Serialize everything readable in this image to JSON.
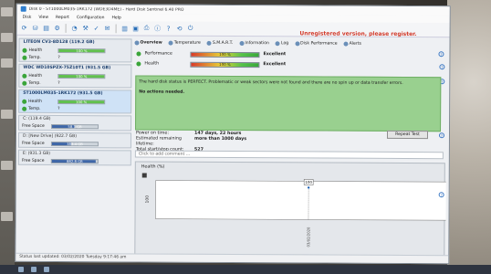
{
  "window": {
    "title": "Disk 0 - ST1000LM035-1RK172 (WDE3D4ME) - Hard Disk Sentinel 6.40 PRO",
    "unregistered": "Unregistered version, please register."
  },
  "menu": [
    "Disk",
    "View",
    "Report",
    "Configuration",
    "Help"
  ],
  "toolbar_icons": [
    "refresh-icon",
    "disk-icon",
    "report-icon",
    "settings-icon",
    "gauge-icon",
    "tools-icon",
    "test-icon",
    "email-icon",
    "chart-icon",
    "save-icon",
    "print-icon",
    "info-icon",
    "help-icon",
    "update-icon",
    "power-icon"
  ],
  "drives": [
    {
      "name": "LITEON CV3-8D128 (119.2 GB)",
      "health_label": "Health",
      "health": "100 %",
      "health_pct": 100,
      "temp_label": "Temp.",
      "temp": "?",
      "selected": false
    },
    {
      "name": "WDC WD10SPZX-75Z10T1 (931.5 GB)",
      "health_label": "Health",
      "health": "100 %",
      "health_pct": 100,
      "temp_label": "Temp.",
      "temp": "?",
      "selected": false
    },
    {
      "name": "ST1000LM035-1RK172 (931.5 GB)",
      "health_label": "Health",
      "health": "100 %",
      "health_pct": 100,
      "temp_label": "Temp.",
      "temp": "?",
      "selected": true
    }
  ],
  "volumes": [
    {
      "head": "C: (119.4 GB)",
      "label": "Free Space",
      "value": "58.1 GB",
      "pct": 49
    },
    {
      "head": "D: [New Drive] (922.7 GB)",
      "label": "Free Space",
      "value": "383.4 GB",
      "pct": 42
    },
    {
      "head": "E: (931.3 GB)",
      "label": "Free Space",
      "value": "882.8 GB",
      "pct": 95
    }
  ],
  "tabs": [
    "Overview",
    "Temperature",
    "S.M.A.R.T.",
    "Information",
    "Log",
    "Disk Performance",
    "Alerts"
  ],
  "metrics": [
    {
      "label": "Performance",
      "value": "100 %",
      "status": "Excellent"
    },
    {
      "label": "Health",
      "value": "100 %",
      "status": "Excellent"
    }
  ],
  "status": {
    "line1": "The hard disk status is PERFECT. Problematic or weak sectors were not found and there are no spin up or data transfer errors.",
    "line2": "No actions needed."
  },
  "info": [
    {
      "key": "Power on time:",
      "value": "147 days, 22 hours"
    },
    {
      "key": "Estimated remaining lifetime:",
      "value": "more than 1000 days"
    },
    {
      "key": "Total start/stop count:",
      "value": "527"
    }
  ],
  "repeat_test_label": "Repeat Test",
  "comment_placeholder": "Click to add comment ...",
  "chart_data": {
    "type": "line",
    "title": "Health (%)",
    "x": [
      "03/02/2020"
    ],
    "values": [
      100
    ],
    "ylabel": "100",
    "point_label": "100"
  },
  "statusbar": "Status last updated: 03/02/2020 Tuesday 9:17:46 am"
}
